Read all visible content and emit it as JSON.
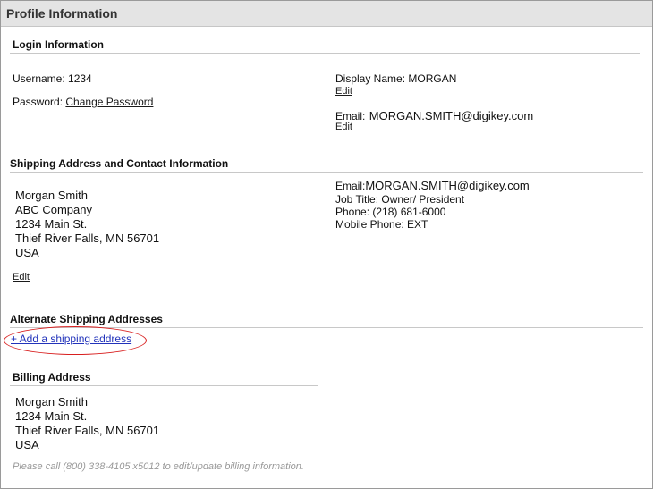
{
  "panel": {
    "title": "Profile Information"
  },
  "login": {
    "heading": "Login Information",
    "username_label": "Username:",
    "username_value": "1234",
    "password_label": "Password:",
    "change_password": "Change Password",
    "display_name_label": "Display Name:",
    "display_name_value": "MORGAN",
    "display_edit": "Edit",
    "email_label": "Email:",
    "email_value": "MORGAN.SMITH@digikey.com",
    "email_edit": "Edit"
  },
  "shipping": {
    "heading": "Shipping Address and Contact Information",
    "address_lines": [
      "Morgan Smith",
      "ABC Company",
      "1234 Main St.",
      "Thief River Falls, MN 56701",
      "USA"
    ],
    "edit": "Edit",
    "email_label": "Email:",
    "email_value": "MORGAN.SMITH@digikey.com",
    "job_title": "Job Title: Owner/ President",
    "phone": "Phone: (218) 681-6000",
    "mobile": "Mobile Phone: EXT"
  },
  "alternate": {
    "heading": "Alternate Shipping Addresses",
    "add_link": "+ Add a shipping address",
    "highlight_color": "#d81f1f"
  },
  "billing": {
    "heading": "Billing Address",
    "address_lines": [
      "Morgan Smith",
      "1234 Main St.",
      "Thief River Falls, MN 56701",
      "USA"
    ],
    "note": "Please call (800) 338-4105 x5012 to edit/update billing information."
  }
}
